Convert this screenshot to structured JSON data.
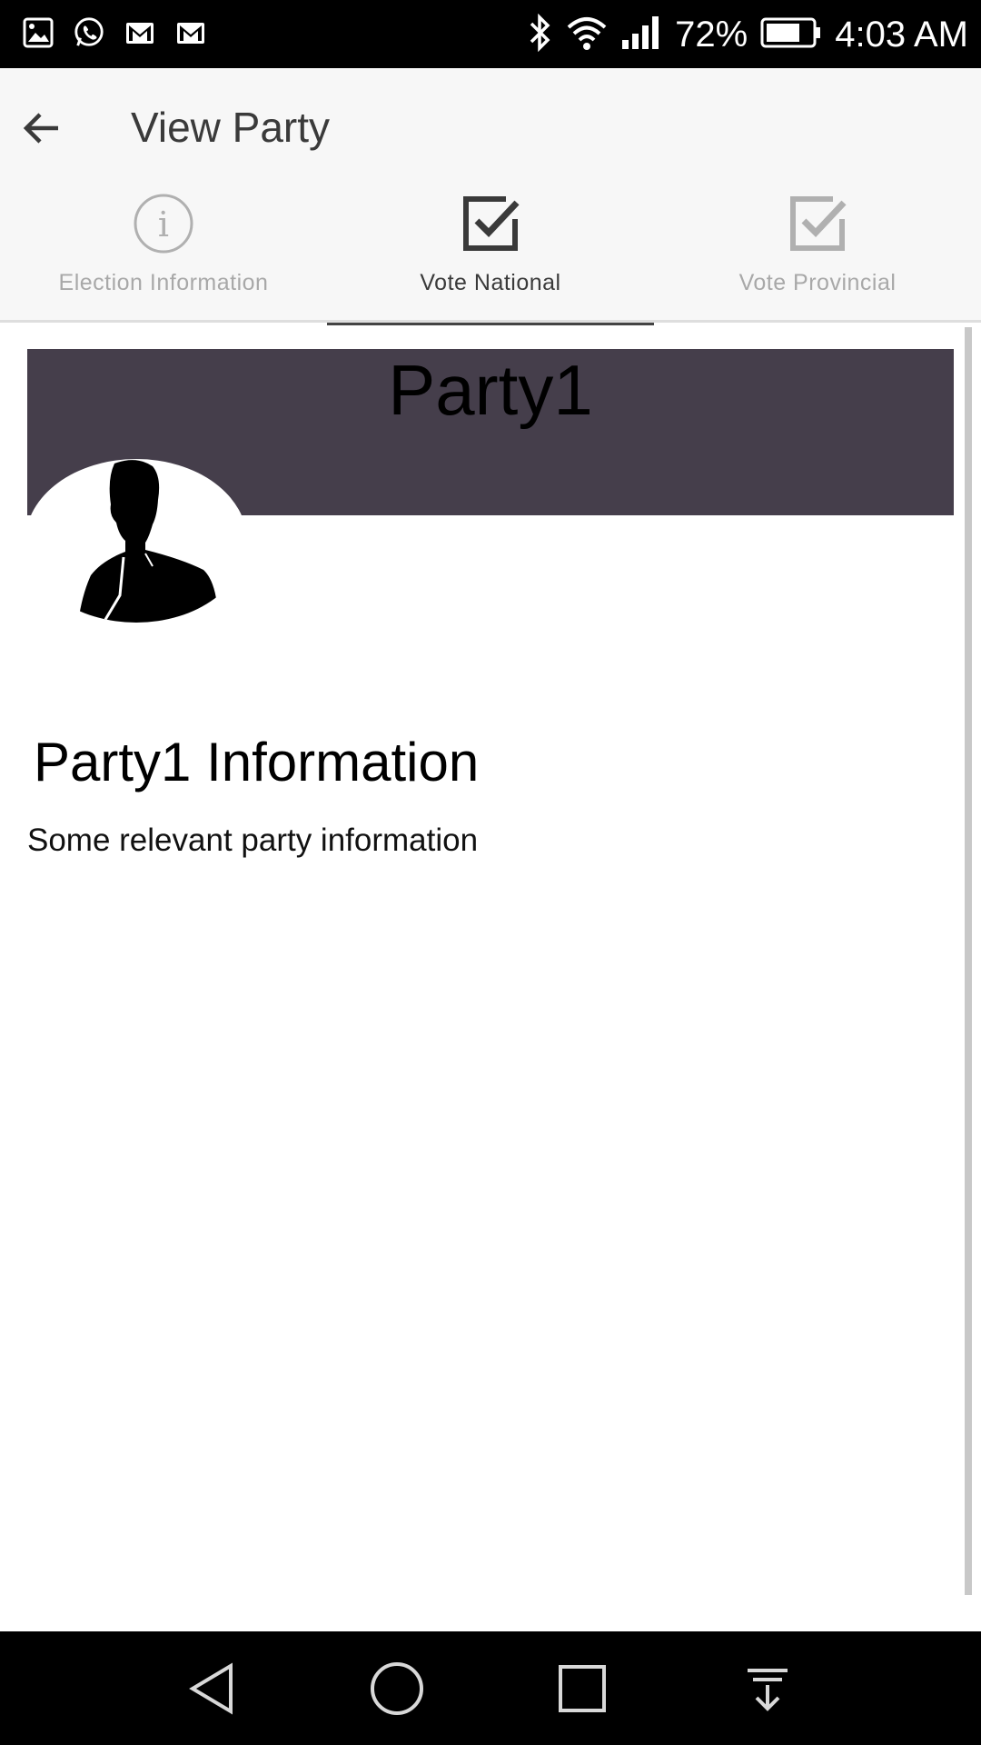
{
  "status_bar": {
    "battery": "72%",
    "time": "4:03 AM"
  },
  "header": {
    "title": "View Party"
  },
  "tabs": [
    {
      "label": "Election Information",
      "icon": "info-icon",
      "active": false
    },
    {
      "label": "Vote National",
      "icon": "checkbox-icon",
      "active": true
    },
    {
      "label": "Vote Provincial",
      "icon": "checkbox-icon",
      "active": false
    }
  ],
  "party": {
    "name": "Party1",
    "info_title": "Party1 Information",
    "info_text": "Some relevant party information"
  },
  "colors": {
    "banner": "#453e4b",
    "app_bar": "#f7f7f7",
    "tab_indicator": "#444444"
  }
}
